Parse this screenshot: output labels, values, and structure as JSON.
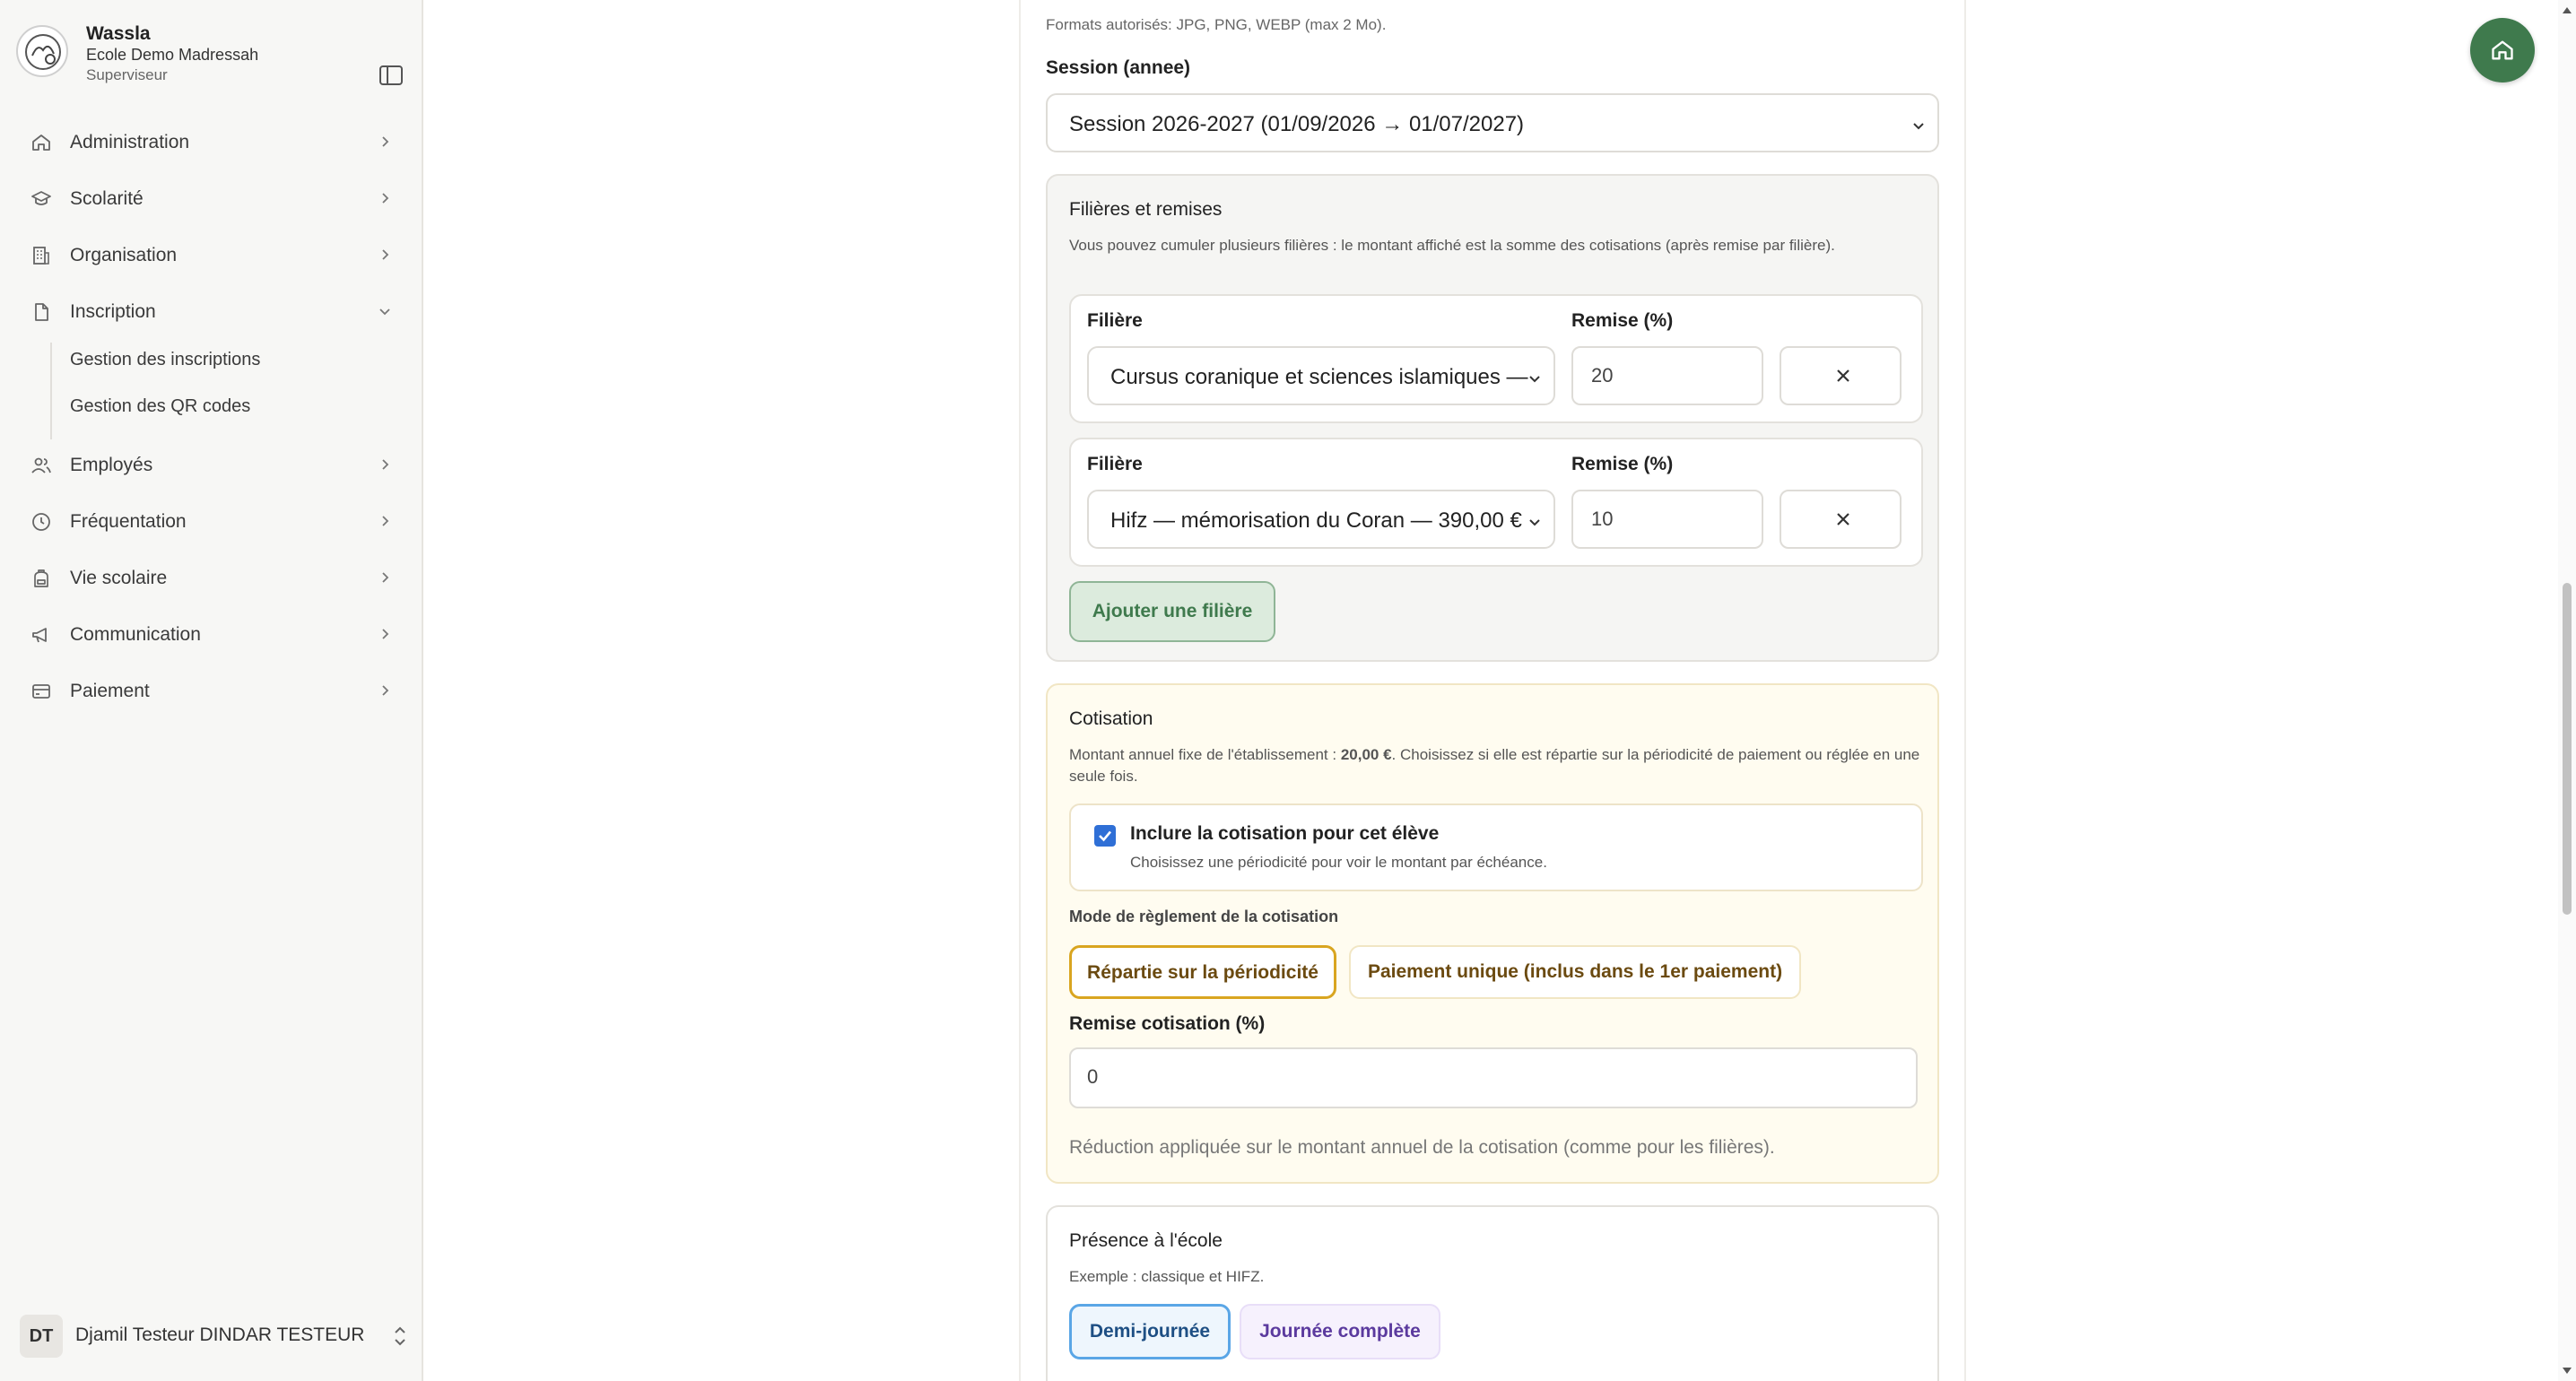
{
  "sidebar": {
    "brand": {
      "name": "Wassla",
      "school": "Ecole Demo Madressah",
      "role": "Superviseur"
    },
    "items": [
      {
        "label": "Administration",
        "icon": "home-icon"
      },
      {
        "label": "Scolarité",
        "icon": "graduation-cap-icon"
      },
      {
        "label": "Organisation",
        "icon": "building-icon"
      },
      {
        "label": "Inscription",
        "icon": "document-icon",
        "expanded": true,
        "children": [
          "Gestion des inscriptions",
          "Gestion des QR codes"
        ]
      },
      {
        "label": "Employés",
        "icon": "users-icon"
      },
      {
        "label": "Fréquentation",
        "icon": "clock-icon"
      },
      {
        "label": "Vie scolaire",
        "icon": "backpack-icon"
      },
      {
        "label": "Communication",
        "icon": "megaphone-icon"
      },
      {
        "label": "Paiement",
        "icon": "credit-card-icon"
      }
    ],
    "user": {
      "initials": "DT",
      "name": "Djamil Testeur DINDAR TESTEUR"
    }
  },
  "form": {
    "formats_hint": "Formats autorisés: JPG, PNG, WEBP (max 2 Mo).",
    "session": {
      "label": "Session (annee)",
      "value": "Session 2026-2027 (01/09/2026 → 01/07/2027)"
    },
    "filieres": {
      "title": "Filières et remises",
      "description": "Vous pouvez cumuler plusieurs filières : le montant affiché est la somme des cotisations (après remise par filière).",
      "rows": [
        {
          "filiere_label": "Filière",
          "filiere_value": "Cursus coranique et sciences islamiques — ...",
          "remise_label": "Remise (%)",
          "remise_value": "20"
        },
        {
          "filiere_label": "Filière",
          "filiere_value": "Hifz — mémorisation du Coran — 390,00 €",
          "remise_label": "Remise (%)",
          "remise_value": "10"
        }
      ],
      "add_button": "Ajouter une filière"
    },
    "cotisation": {
      "title": "Cotisation",
      "description_prefix": "Montant annuel fixe de l'établissement : ",
      "amount": "20,00 €",
      "description_suffix": ". Choisissez si elle est répartie sur la périodicité de paiement ou réglée en une seule fois.",
      "include_label": "Inclure la cotisation pour cet élève",
      "include_help": "Choisissez une périodicité pour voir le montant par échéance.",
      "include_checked": true,
      "mode_label": "Mode de règlement de la cotisation",
      "mode_options": [
        "Répartie sur la périodicité",
        "Paiement unique (inclus dans le 1er paiement)"
      ],
      "mode_selected": "Répartie sur la périodicité",
      "remise_label": "Remise cotisation (%)",
      "remise_value": "0",
      "remise_help": "Réduction appliquée sur le montant annuel de la cotisation (comme pour les filières)."
    },
    "presence": {
      "title": "Présence à l'école",
      "example": "Exemple : classique et HIFZ.",
      "options": [
        "Demi-journée",
        "Journée complète"
      ],
      "selected": "Demi-journée"
    }
  },
  "colors": {
    "brand_green": "#3f7a4d",
    "cotisation_bg": "#fffcf0",
    "cotisation_border": "#f1e6c4",
    "selected_amber": "#d9a520",
    "selected_blue": "#5aa6e6",
    "violet_text": "#5b3a9e"
  }
}
